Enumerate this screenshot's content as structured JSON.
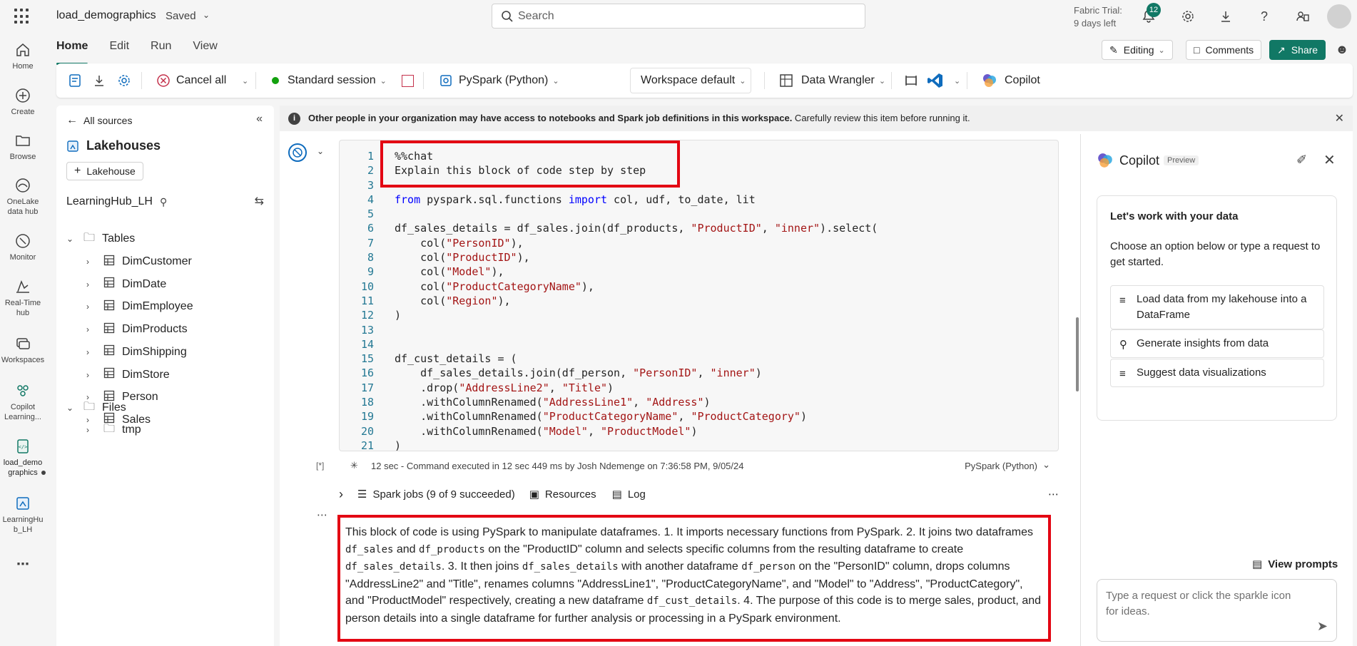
{
  "topbar": {
    "doc_title": "load_demographics",
    "saved": "Saved",
    "search_placeholder": "Search",
    "trial_line1": "Fabric Trial:",
    "trial_line2": "9 days left",
    "notifications": "12"
  },
  "rail": [
    {
      "label": "Home",
      "icon": "home-icon"
    },
    {
      "label": "Create",
      "icon": "create-icon"
    },
    {
      "label": "Browse",
      "icon": "browse-icon"
    },
    {
      "label1": "OneLake",
      "label2": "data hub",
      "icon": "onelake-icon"
    },
    {
      "label": "Monitor",
      "icon": "monitor-icon"
    },
    {
      "label1": "Real-Time",
      "label2": "hub",
      "icon": "realtime-icon"
    },
    {
      "label": "Workspaces",
      "icon": "workspaces-icon"
    },
    {
      "label1": "Copilot",
      "label2": "Learning...",
      "icon": "copilot-learning-icon"
    },
    {
      "label1": "load_demo",
      "label2": "graphics",
      "icon": "notebook-icon"
    },
    {
      "label1": "LearningHu",
      "label2": "b_LH",
      "icon": "lakehouse-icon"
    }
  ],
  "ribbon": {
    "tabs": [
      "Home",
      "Edit",
      "Run",
      "View"
    ],
    "editing": "Editing",
    "comments": "Comments",
    "share": "Share",
    "cancel_all": "Cancel all",
    "session": "Standard session",
    "language": "PySpark (Python)",
    "workspace": "Workspace default",
    "data_wrangler": "Data Wrangler",
    "copilot": "Copilot"
  },
  "explorer": {
    "all_sources": "All sources",
    "lakehouses": "Lakehouses",
    "add_lakehouse": "Lakehouse",
    "lakehouse_name": "LearningHub_LH",
    "tables_label": "Tables",
    "tables": [
      "DimCustomer",
      "DimDate",
      "DimEmployee",
      "DimProducts",
      "DimShipping",
      "DimStore",
      "Person",
      "Sales"
    ],
    "files_label": "Files",
    "files": [
      "tmp"
    ]
  },
  "banner": {
    "bold": "Other people in your organization may have access to notebooks and Spark job definitions in this workspace.",
    "rest": " Carefully review this item before running it."
  },
  "cell": {
    "line_numbers": [
      "1",
      "2",
      "3",
      "4",
      "5",
      "6",
      "7",
      "8",
      "9",
      "10",
      "11",
      "12",
      "13",
      "14",
      "15",
      "16",
      "17",
      "18",
      "19",
      "20",
      "21"
    ],
    "exec_count": "[*]",
    "footer_status": "12 sec - Command executed in 12 sec 449 ms by Josh Ndemenge on 7:36:58 PM, 9/05/24",
    "footer_lang": "PySpark (Python)",
    "spark_jobs": "Spark jobs (9 of 9 succeeded)",
    "resources": "Resources",
    "log": "Log"
  },
  "output": {
    "t1": "This block of code is using PySpark to manipulate dataframes. 1. It imports necessary functions from PySpark. 2. It joins two dataframes ",
    "c1": "df_sales",
    "t2": " and ",
    "c2": "df_products",
    "t3": " on the \"ProductID\" column and selects specific columns from the resulting dataframe to create ",
    "c3": "df_sales_details",
    "t4": ". 3. It then joins ",
    "c4": "df_sales_details",
    "t5": " with another dataframe ",
    "c5": "df_person",
    "t6": " on the \"PersonID\" column, drops columns \"AddressLine2\" and \"Title\", renames columns \"AddressLine1\", \"ProductCategoryName\", and \"Model\" to \"Address\", \"ProductCategory\", and \"ProductModel\" respectively, creating a new dataframe ",
    "c6": "df_cust_details",
    "t7": ". 4. The purpose of this code is to merge sales, product, and person details into a single dataframe for further analysis or processing in a PySpark environment."
  },
  "copilot": {
    "title": "Copilot",
    "preview": "Preview",
    "card_heading": "Let's work with your data",
    "card_text": "Choose an option below or type a request to get started.",
    "options": [
      "Load data from my lakehouse into a DataFrame",
      "Generate insights from data",
      "Suggest data visualizations"
    ],
    "view_prompts": "View prompts",
    "input_placeholder": "Type a request or click the sparkle icon for ideas."
  },
  "colors": {
    "accent": "#117865",
    "highlight": "#e30613",
    "keyword": "#0000ff",
    "string": "#a31515"
  }
}
